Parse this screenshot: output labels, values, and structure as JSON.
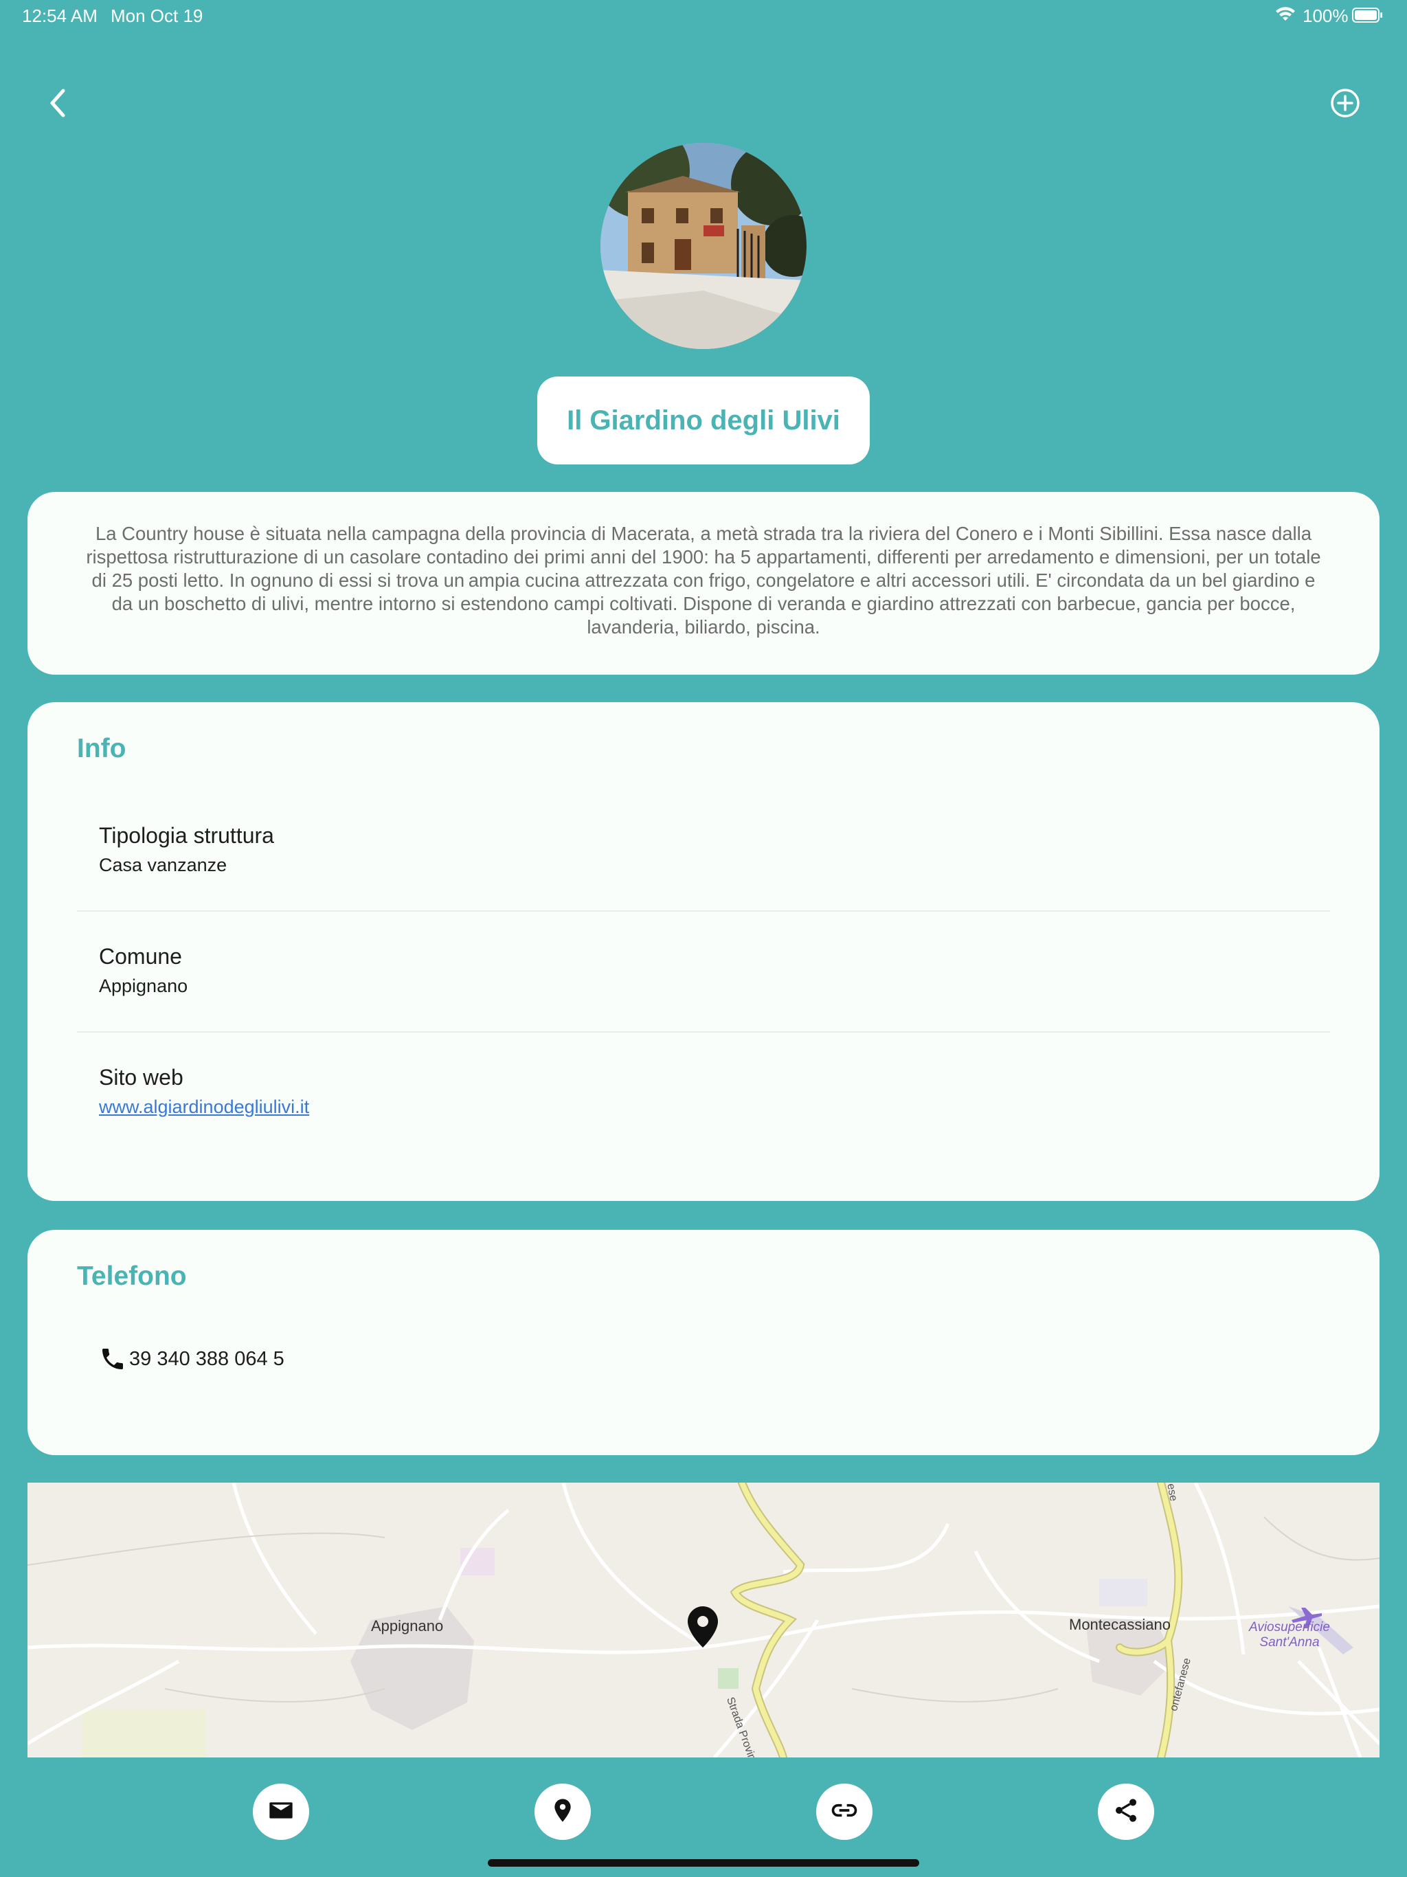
{
  "status_bar": {
    "time": "12:54 AM",
    "date": "Mon Oct 19",
    "battery": "100%"
  },
  "header": {
    "title": "Il Giardino degli Ulivi"
  },
  "description": "La Country house è situata nella campagna della provincia di Macerata, a metà strada tra la riviera del Conero e i Monti Sibillini. Essa nasce dalla rispettosa ristrutturazione di un casolare contadino dei primi anni del 1900: ha 5 appartamenti, differenti per arredamento e dimensioni, per un totale di 25 posti letto. In ognuno di essi si trova un ampia cucina attrezzata con frigo, congelatore e altri accessori utili. E' circondata da un bel giardino e da un boschetto di ulivi, mentre intorno si estendono campi coltivati. Dispone di veranda e giardino attrezzati con barbecue, gancia per bocce, lavanderia, biliardo, piscina.",
  "info": {
    "title": "Info",
    "rows": [
      {
        "label": "Tipologia struttura",
        "value": "Casa vanzanze"
      },
      {
        "label": "Comune",
        "value": "Appignano"
      },
      {
        "label": "Sito web",
        "value": "www.algiardinodegliulivi.it"
      }
    ]
  },
  "phone": {
    "title": "Telefono",
    "number": "39 340 388 064 5"
  },
  "map": {
    "labels": {
      "town1": "Appignano",
      "town2": "Montecassiano",
      "airfield_line1": "Aviosuperficie",
      "airfield_line2": "Sant'Anna",
      "road1": "Strada Provinciale",
      "road2": "ontefanese",
      "road3": "ese"
    }
  },
  "icons": {
    "back": "chevron-left-icon",
    "add": "add-circle-icon",
    "email": "email-icon",
    "location": "location-pin-icon",
    "link": "link-icon",
    "share": "share-icon",
    "phone": "phone-icon"
  },
  "colors": {
    "accent": "#4AB3B4",
    "card": "#FAFEFA",
    "link": "#3a78d8"
  }
}
